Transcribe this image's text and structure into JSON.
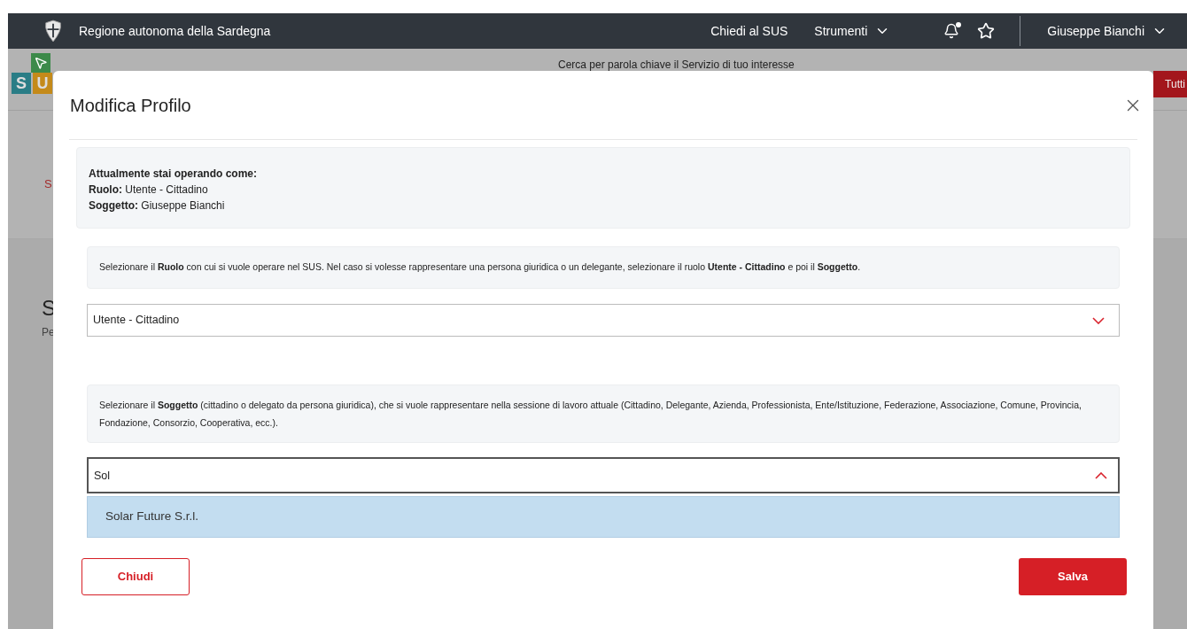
{
  "header": {
    "brand": "Regione autonoma della Sardegna",
    "links": [
      {
        "label": "Chiedi al SUS",
        "kind": "link"
      },
      {
        "label": "Strumenti",
        "kind": "menu"
      }
    ],
    "notification_dot": true,
    "user": "Giuseppe Bianchi"
  },
  "background_page": {
    "logo_letters": [
      "S",
      "U"
    ],
    "search_hint": "Cerca per parola chiave il Servizio di tuo interesse",
    "button": "Tutti",
    "breadcrumb": "S",
    "heading": "S",
    "subtitle": "Pe"
  },
  "modal": {
    "title": "Modifica Profilo",
    "current": {
      "heading": "Attualmente stai operando come:",
      "lines": [
        "**Ruolo:** Utente - Cittadino",
        "**Soggetto:** Giuseppe Bianchi"
      ]
    },
    "role_help": "Selezionare il **Ruolo** con cui si vuole operare nel SUS. Nel caso si volesse rappresentare una persona giuridica o un delegante, selezionare il ruolo **Utente - Cittadino** e poi il **Soggetto**.",
    "role_select": {
      "value": "Utente - Cittadino",
      "expanded": false
    },
    "subject_help": "Selezionare il **Soggetto** (cittadino o delegato da persona giuridica), che si vuole rappresentare nella sessione di lavoro attuale (Cittadino, Delegante, Azienda, Professionista, Ente/Istituzione, Federazione, Associazione, Comune, Provincia, Fondazione, Consorzio, Cooperativa, ecc.).",
    "subject_field": {
      "value": "Sol",
      "expanded": true
    },
    "options": [
      {
        "label": "Solar Future S.r.l.",
        "selected": true
      }
    ],
    "buttons": [
      {
        "label": "Chiudi",
        "kind": "secondary"
      },
      {
        "label": "Salva",
        "kind": "primary"
      }
    ]
  }
}
